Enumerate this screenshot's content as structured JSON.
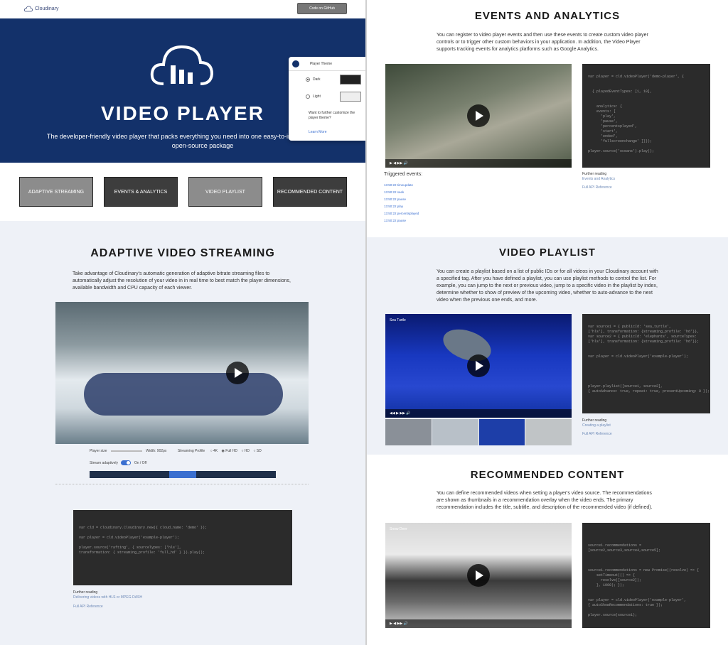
{
  "nav": {
    "logo_text": "Cloudinary",
    "github_button": "Code on GitHub"
  },
  "hero": {
    "title": "VIDEO PLAYER",
    "subtitle": "The developer-friendly video player that packs everything you need into one easy-to-integrate, comprehensive open-source package",
    "theme_panel": {
      "header": "Player Theme",
      "options": [
        {
          "label": "Dark",
          "selected": true
        },
        {
          "label": "Light",
          "selected": false
        }
      ],
      "question": "Want to further customize the player theme?",
      "link": "Learn More"
    }
  },
  "cards": [
    {
      "label": "ADAPTIVE STREAMING"
    },
    {
      "label": "EVENTS & ANALYTICS"
    },
    {
      "label": "VIDEO PLAYLIST"
    },
    {
      "label": "RECOMMENDED CONTENT"
    }
  ],
  "adaptive": {
    "title": "ADAPTIVE VIDEO STREAMING",
    "body": "Take advantage of Cloudinary's automatic generation of adaptive bitrate streaming files to automatically adjust the resolution of your video in in real time to best match the player dimensions, available bandwidth and CPU capacity of each viewer.",
    "player_size_label": "Player size",
    "width_label": "Width: 902px",
    "streaming_profile_label": "Streaming Profile",
    "profiles": [
      "4K",
      "Full HD",
      "HD",
      "SD"
    ],
    "selected_profile": "Full HD",
    "stream_adaptively_label": "Stream adaptively",
    "toggle_label": "On / Off",
    "quality_levels": [
      "",
      "",
      "",
      "",
      "",
      "",
      ""
    ],
    "quality_selected_index": 3,
    "code": "player.source('rafting', { sourceTypes: ['hls'],\n  transformation: { streaming_profile: 'full_hd' } }).play();",
    "code_lines": [
      "",
      "",
      "var cld = cloudinary.Cloudinary.new({ cloud_name: 'demo' });",
      "",
      "var player = cld.videoPlayer('example-player');",
      "",
      "player.source('rafting', { sourceTypes: ['hls'],",
      "transformation: { streaming_profile: 'full_hd' } }).play();"
    ],
    "further_title": "Further reading",
    "further_links": [
      "Delivering videos with HLS or MPEG-DASH",
      "Full API Reference"
    ]
  },
  "events": {
    "title": "EVENTS AND ANALYTICS",
    "body": "You can register to video player events and then use these events to create custom video player controls or to trigger other custom behaviors in your application. In addition, the Video Player supports tracking events for analytics platforms such as Google Analytics.",
    "triggered_label": "Triggered events:",
    "triggered": [
      "13:50:22 timeupdate",
      "13:50:22 seek",
      "13:50:22 pause",
      "13:50:22 play",
      "13:50:22 percentsplayed",
      "13:50:22 pause"
    ],
    "code_lines": [
      "",
      "var player = cld.videoPlayer('demo-player', {",
      "",
      "",
      "  { playedEventTypes: [1, 10],",
      "",
      "",
      "    analytics: {",
      "    events: [",
      "      'play',",
      "      'pause',",
      "      'percentsplayed',",
      "      'start',",
      "      'ended',",
      "      'fullscreenchange' ]}});",
      "",
      "player.source('oceans').play();"
    ],
    "further_title": "Further reading",
    "further_links": [
      "Events and Analytics",
      "Full API Reference"
    ]
  },
  "playlist": {
    "title": "VIDEO PLAYLIST",
    "body": "You can create a playlist based on a list of public IDs or for all videos in your Cloudinary account with a specified tag. After you have defined a playlist, you can use playlist methods to control the list. For example, you can jump to the next or previous video, jump to a specific video in the playlist by index, determine whether to show of preview of the upcoming video, whether to auto-advance to the next video when the previous one ends, and more.",
    "video_title": "Sea Turtle",
    "code_lines": [
      "",
      "var source1 = { publicId: 'sea_turtle',",
      "['hls'], transformation: {streaming_profile: 'hd'}},",
      "var source2 = { publicId: 'elephants', sourceTypes:",
      "['hls'], transformation: {streaming_profile: 'hd'}};",
      "",
      "",
      "var player = cld.videoPlayer('example-player');",
      "",
      "",
      "",
      "",
      "",
      "player.playlist([source1, source2],",
      "{ autoAdvance: true, repeat: true, presentUpcoming: 8 });"
    ],
    "further_title": "Further reading",
    "further_links": [
      "Creating a playlist",
      "Full API Reference"
    ]
  },
  "recommended": {
    "title": "RECOMMENDED CONTENT",
    "body": "You can define recommended videos when setting a player's video source. The recommendations are shown as thumbnails in a recommendation overlay when the video ends. The primary recommendation includes the title, subtitle, and description of the recommended video (if defined).",
    "video_title": "Snow Deer",
    "code_lines": [
      "",
      "",
      "",
      "source1.recommendations =",
      "[source2,source3,source4,source5];",
      "",
      "",
      "",
      "source1.recommendations = new Promise((resolve) => {",
      "    setTimeout(() => {",
      "      resolve([source2]);",
      "    }, 1000); });",
      "",
      "",
      "var player = cld.videoPlayer('example-player',",
      "{ autoShowRecommendations: true });",
      "",
      "player.source(source1);"
    ],
    "further_title": "",
    "further_links": []
  },
  "colors": {
    "hero_bg": "#13316a",
    "accent": "#3a6fd0",
    "code_bg": "#2b2b2b"
  }
}
